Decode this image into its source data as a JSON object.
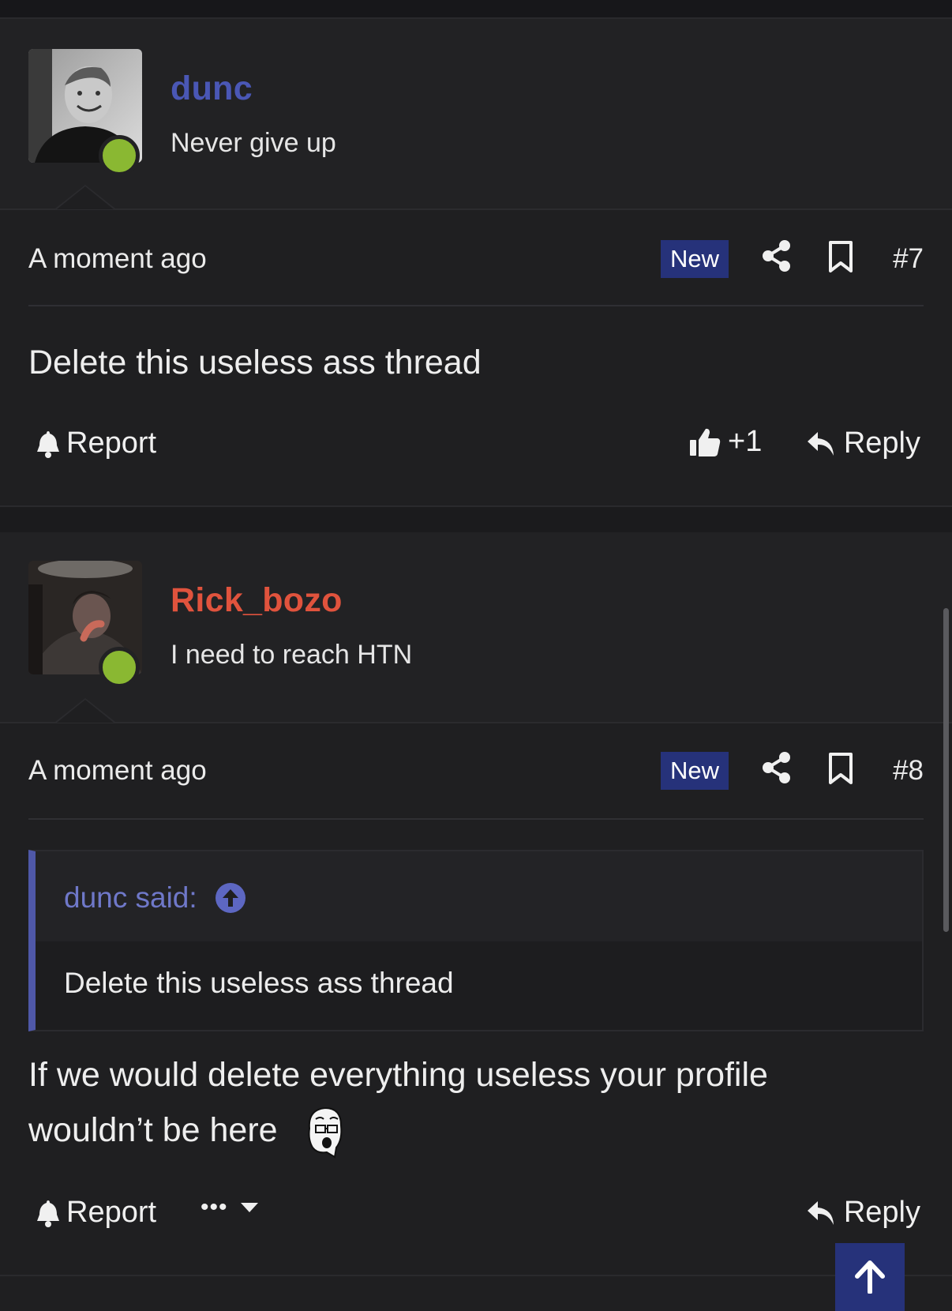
{
  "posts": [
    {
      "username": "dunc",
      "user_title": "Never give up",
      "time": "A moment ago",
      "badge": "New",
      "number": "#7",
      "body": "Delete this useless ass thread",
      "report_label": "Report",
      "like_label": "+1",
      "reply_label": "Reply"
    },
    {
      "username": "Rick_bozo",
      "user_title": "I need to reach HTN",
      "time": "A moment ago",
      "badge": "New",
      "number": "#8",
      "quote": {
        "author": "dunc said:",
        "text": "Delete this useless ass thread"
      },
      "body": "If we would delete everything useless your profile wouldn’t be here",
      "report_label": "Report",
      "more_label": "•••",
      "reply_label": "Reply"
    }
  ],
  "colors": {
    "username_1": "#4a57b5",
    "username_2": "#e0533d",
    "online": "#8ab832",
    "badge_bg": "#26327a"
  },
  "icons": [
    "share-icon",
    "bookmark-icon",
    "bell-icon",
    "thumbs-up-icon",
    "reply-icon",
    "arrow-up-circle-icon",
    "chevron-down-icon",
    "arrow-up-icon"
  ]
}
